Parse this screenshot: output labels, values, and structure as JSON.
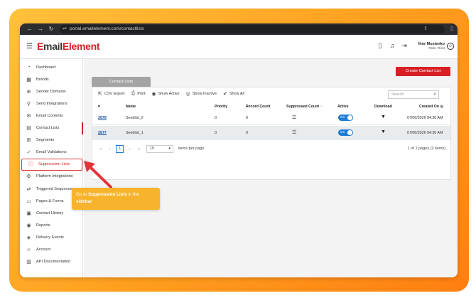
{
  "browser": {
    "url": "portal.emailelement.com/contactlists",
    "nav_back": "←",
    "nav_forward": "→",
    "nav_reload": "↻",
    "tune_icon": "⇌",
    "share_icon": "⇪",
    "window_icon": "▯"
  },
  "header": {
    "logo_prefix": "E",
    "logo_mid": "mail",
    "logo_suffix": "Element",
    "user_name": "Ihor Musienko",
    "user_role": "Role: Root",
    "icons": [
      "phone-icon",
      "bell-icon",
      "logout-icon"
    ]
  },
  "sidebar": {
    "items": [
      {
        "label": "Dashboard",
        "icon": "dashboard-icon",
        "glyph": "◔"
      },
      {
        "label": "Brands",
        "icon": "brands-icon",
        "glyph": "▦"
      },
      {
        "label": "Sender Domains",
        "icon": "globe-icon",
        "glyph": "⊕"
      },
      {
        "label": "Send Integrations",
        "icon": "plug-icon",
        "glyph": "⚲"
      },
      {
        "label": "Email Contents",
        "icon": "envelope-icon",
        "glyph": "✉"
      },
      {
        "label": "Contact Lists",
        "icon": "contact-list-icon",
        "glyph": "▤"
      },
      {
        "label": "Segments",
        "icon": "segments-icon",
        "glyph": "⊞"
      },
      {
        "label": "Email Validations",
        "icon": "check-circle-icon",
        "glyph": "✓"
      },
      {
        "label": "Suppression Lists",
        "icon": "alert-circle-icon",
        "glyph": "ⓘ"
      },
      {
        "label": "Platform Integrations",
        "icon": "gear-icon",
        "glyph": "⚙"
      },
      {
        "label": "Triggered Sequences",
        "icon": "sequence-icon",
        "glyph": "⇄"
      },
      {
        "label": "Pages & Forms",
        "icon": "pages-icon",
        "glyph": "▭"
      },
      {
        "label": "Contact History",
        "icon": "history-icon",
        "glyph": "▣"
      },
      {
        "label": "Reports",
        "icon": "reports-icon",
        "glyph": "◉"
      },
      {
        "label": "Delivery Events",
        "icon": "delivery-icon",
        "glyph": "◈"
      },
      {
        "label": "Account",
        "icon": "account-icon",
        "glyph": "☺"
      },
      {
        "label": "API Documentation",
        "icon": "api-doc-icon",
        "glyph": "▥"
      }
    ]
  },
  "main": {
    "create_button": "Create Contact List",
    "tab_label": "Contact Lists",
    "toolbar": {
      "csv_export": "CSV Export",
      "print": "Print",
      "show_active": "Show Active",
      "show_inactive": "Show Inactive",
      "show_all": "Show All"
    },
    "search_placeholder": "Search",
    "columns": [
      "#",
      "Name",
      "Priority",
      "Record Count",
      "Suppressed Count",
      "Active",
      "Download",
      "Created On"
    ],
    "rows": [
      {
        "id": "2678",
        "name": "Seedlist_2",
        "priority": "0",
        "record_count": "0",
        "active": "On",
        "created_on": "07/06/2026 04:30 AM"
      },
      {
        "id": "2677",
        "name": "Seedlist_1",
        "priority": "0",
        "record_count": "0",
        "active": "On",
        "created_on": "07/06/2026 04:30 AM"
      }
    ],
    "pager": {
      "first": "«",
      "prev": "‹",
      "current_page": "1",
      "next": "›",
      "last": "»",
      "page_size": "15",
      "per_page_label": "items per page",
      "info": "1 of 1 pages (2 items)"
    }
  },
  "tooltip": {
    "prefix": "Go to ",
    "bold1": "Suppression Lists",
    "mid": " in the ",
    "bold2": "sidebar"
  },
  "colors": {
    "brand_red": "#d71f26",
    "toggle_blue": "#1e7cd6",
    "tooltip_orange": "#f7b32b",
    "frame_orange": "#ff9d1e"
  }
}
